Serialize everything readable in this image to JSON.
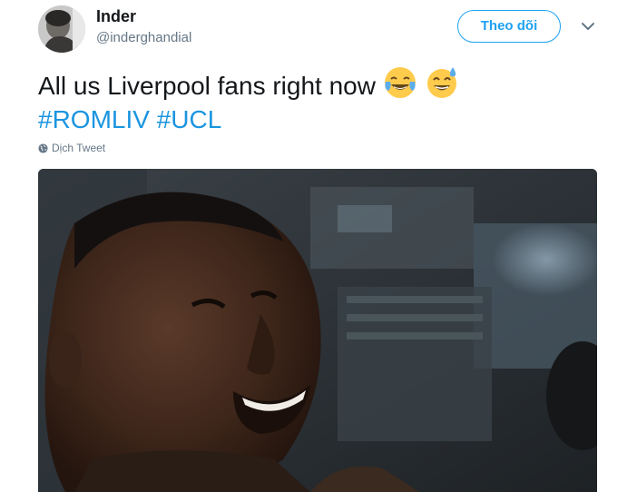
{
  "user": {
    "name": "Inder",
    "handle": "@inderghandial"
  },
  "header": {
    "follow_label": "Theo dõi",
    "more_icon": "chevron-down-icon"
  },
  "tweet": {
    "text": "All us Liverpool fans right now",
    "emojis": [
      "face-with-tears-of-joy-emoji",
      "smiling-face-with-sweat-emoji"
    ],
    "hashtags": [
      "#ROMLIV",
      "#UCL"
    ],
    "translate_label": "Dịch Tweet"
  },
  "colors": {
    "accent": "#1da1f2",
    "link": "#1b95e0",
    "secondary_text": "#657786",
    "primary_text": "#14171a"
  }
}
